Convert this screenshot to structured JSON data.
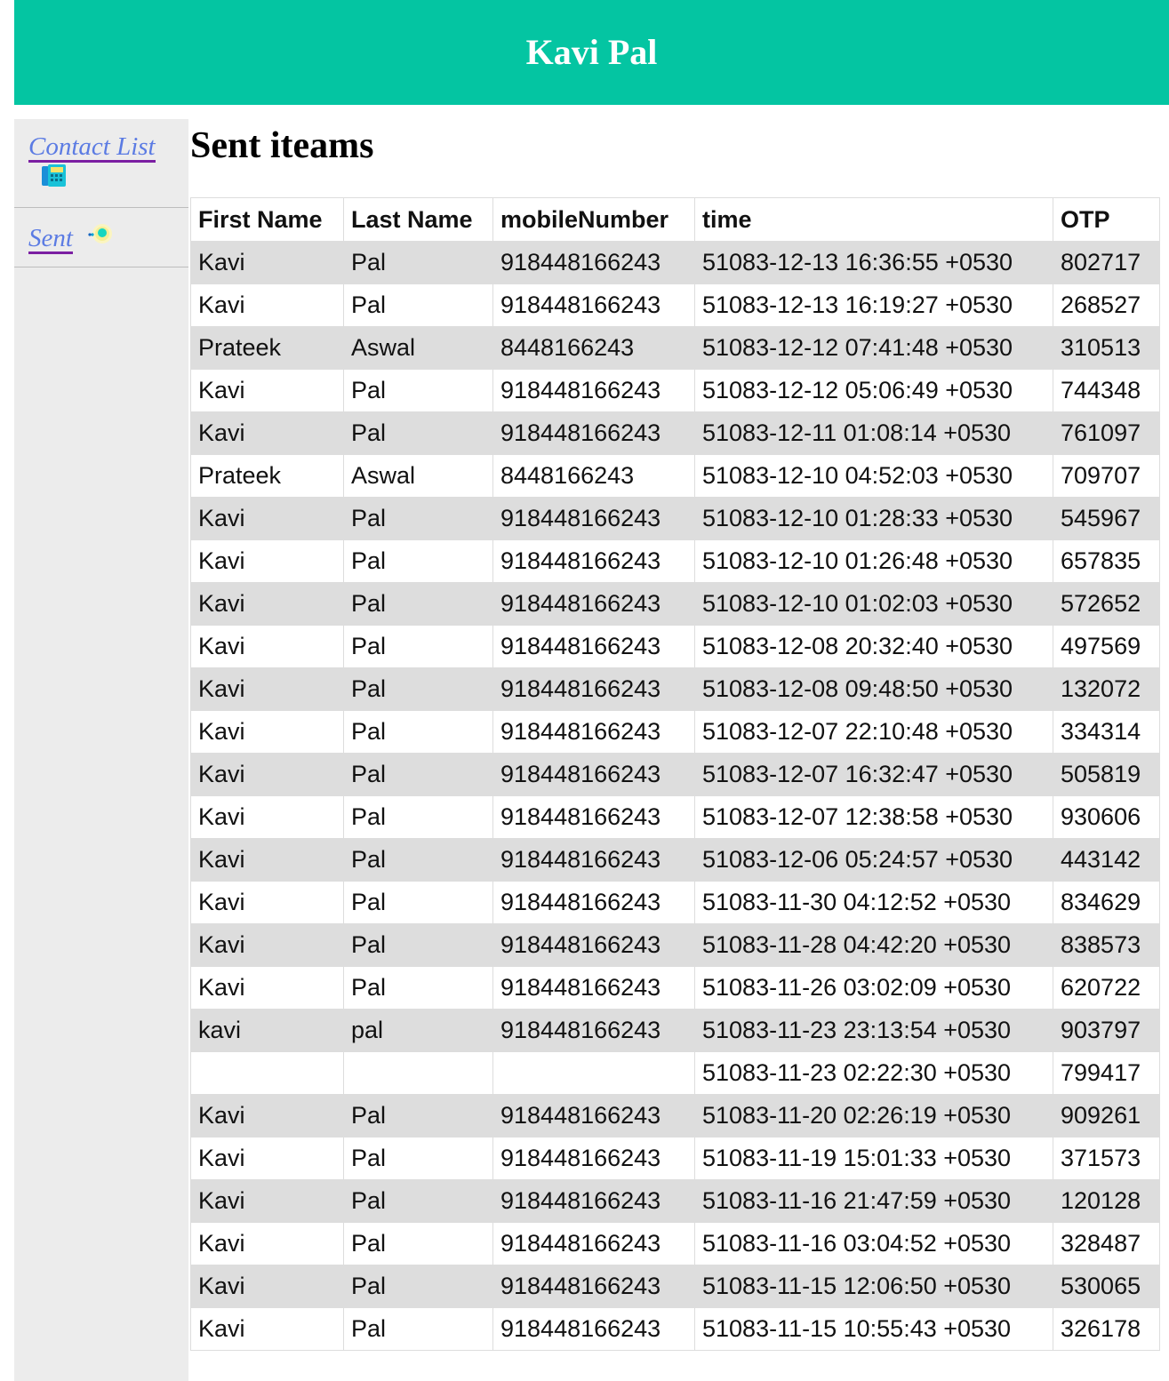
{
  "header": {
    "title": "Kavi Pal"
  },
  "sidebar": {
    "contact_list_label": "Contact List",
    "contact_list_icon": "phone-icon",
    "sent_label": "Sent",
    "sent_icon": "sent-icon"
  },
  "page": {
    "title": "Sent iteams"
  },
  "table": {
    "columns": [
      "First Name",
      "Last Name",
      "mobileNumber",
      "time",
      "OTP"
    ],
    "rows": [
      [
        "Kavi",
        "Pal",
        "918448166243",
        "51083-12-13 16:36:55 +0530",
        "802717"
      ],
      [
        "Kavi",
        "Pal",
        "918448166243",
        "51083-12-13 16:19:27 +0530",
        "268527"
      ],
      [
        "Prateek",
        "Aswal",
        "8448166243",
        "51083-12-12 07:41:48 +0530",
        "310513"
      ],
      [
        "Kavi",
        "Pal",
        "918448166243",
        "51083-12-12 05:06:49 +0530",
        "744348"
      ],
      [
        "Kavi",
        "Pal",
        "918448166243",
        "51083-12-11 01:08:14 +0530",
        "761097"
      ],
      [
        "Prateek",
        "Aswal",
        "8448166243",
        "51083-12-10 04:52:03 +0530",
        "709707"
      ],
      [
        "Kavi",
        "Pal",
        "918448166243",
        "51083-12-10 01:28:33 +0530",
        "545967"
      ],
      [
        "Kavi",
        "Pal",
        "918448166243",
        "51083-12-10 01:26:48 +0530",
        "657835"
      ],
      [
        "Kavi",
        "Pal",
        "918448166243",
        "51083-12-10 01:02:03 +0530",
        "572652"
      ],
      [
        "Kavi",
        "Pal",
        "918448166243",
        "51083-12-08 20:32:40 +0530",
        "497569"
      ],
      [
        "Kavi",
        "Pal",
        "918448166243",
        "51083-12-08 09:48:50 +0530",
        "132072"
      ],
      [
        "Kavi",
        "Pal",
        "918448166243",
        "51083-12-07 22:10:48 +0530",
        "334314"
      ],
      [
        "Kavi",
        "Pal",
        "918448166243",
        "51083-12-07 16:32:47 +0530",
        "505819"
      ],
      [
        "Kavi",
        "Pal",
        "918448166243",
        "51083-12-07 12:38:58 +0530",
        "930606"
      ],
      [
        "Kavi",
        "Pal",
        "918448166243",
        "51083-12-06 05:24:57 +0530",
        "443142"
      ],
      [
        "Kavi",
        "Pal",
        "918448166243",
        "51083-11-30 04:12:52 +0530",
        "834629"
      ],
      [
        "Kavi",
        "Pal",
        "918448166243",
        "51083-11-28 04:42:20 +0530",
        "838573"
      ],
      [
        "Kavi",
        "Pal",
        "918448166243",
        "51083-11-26 03:02:09 +0530",
        "620722"
      ],
      [
        "kavi",
        "pal",
        "918448166243",
        "51083-11-23 23:13:54 +0530",
        "903797"
      ],
      [
        "",
        "",
        "",
        "51083-11-23 02:22:30 +0530",
        "799417"
      ],
      [
        "Kavi",
        "Pal",
        "918448166243",
        "51083-11-20 02:26:19 +0530",
        "909261"
      ],
      [
        "Kavi",
        "Pal",
        "918448166243",
        "51083-11-19 15:01:33 +0530",
        "371573"
      ],
      [
        "Kavi",
        "Pal",
        "918448166243",
        "51083-11-16 21:47:59 +0530",
        "120128"
      ],
      [
        "Kavi",
        "Pal",
        "918448166243",
        "51083-11-16 03:04:52 +0530",
        "328487"
      ],
      [
        "Kavi",
        "Pal",
        "918448166243",
        "51083-11-15 12:06:50 +0530",
        "530065"
      ],
      [
        "Kavi",
        "Pal",
        "918448166243",
        "51083-11-15 10:55:43 +0530",
        "326178"
      ]
    ]
  }
}
